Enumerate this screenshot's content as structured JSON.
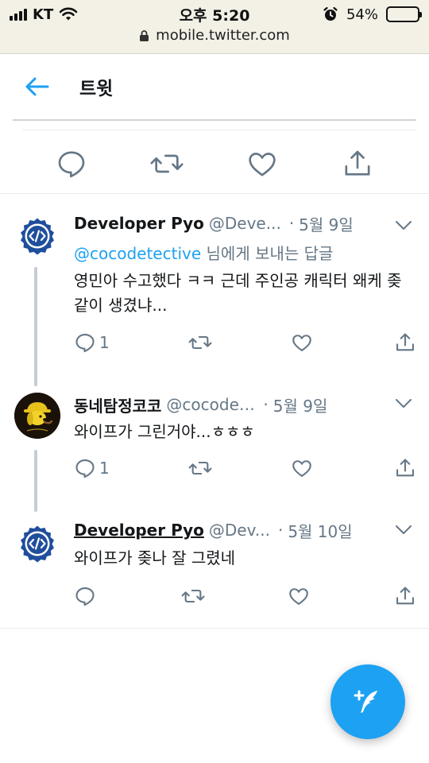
{
  "status_bar": {
    "carrier": "KT",
    "time": "오후 5:20",
    "battery_percent": "54%",
    "battery_level": 0.54,
    "url": "mobile.twitter.com"
  },
  "header": {
    "title": "트윗",
    "back_icon": "back-arrow-icon"
  },
  "main_actions": [
    "reply-icon",
    "retweet-icon",
    "like-icon",
    "share-icon"
  ],
  "tweets": [
    {
      "name": "Developer Pyo",
      "handle": "@Deve...",
      "separator": "·",
      "date": "5월 9일",
      "reply_to_mention": "@cocodetective",
      "reply_to_suffix": " 님에게 보내는 답글",
      "text": "영민아 수고했다 ㅋㅋ 근데 주인공 캐릭터 왜케 좆같이 생겼냐...",
      "reply_count": "1"
    },
    {
      "name": "동네탐정코코",
      "handle": "@cocodet...",
      "separator": "·",
      "date": "5월 9일",
      "text": "와이프가 그린거야...ㅎㅎㅎ",
      "reply_count": "1"
    },
    {
      "name": "Developer Pyo",
      "handle": "@Dev...",
      "separator": "·",
      "date": "5월 10일",
      "text": "와이프가 좆나 잘 그렸네",
      "reply_count": ""
    }
  ],
  "colors": {
    "accent": "#1da1f2",
    "text": "#14171a",
    "muted": "#657786",
    "status_bar_bg": "#f3f1e6"
  }
}
